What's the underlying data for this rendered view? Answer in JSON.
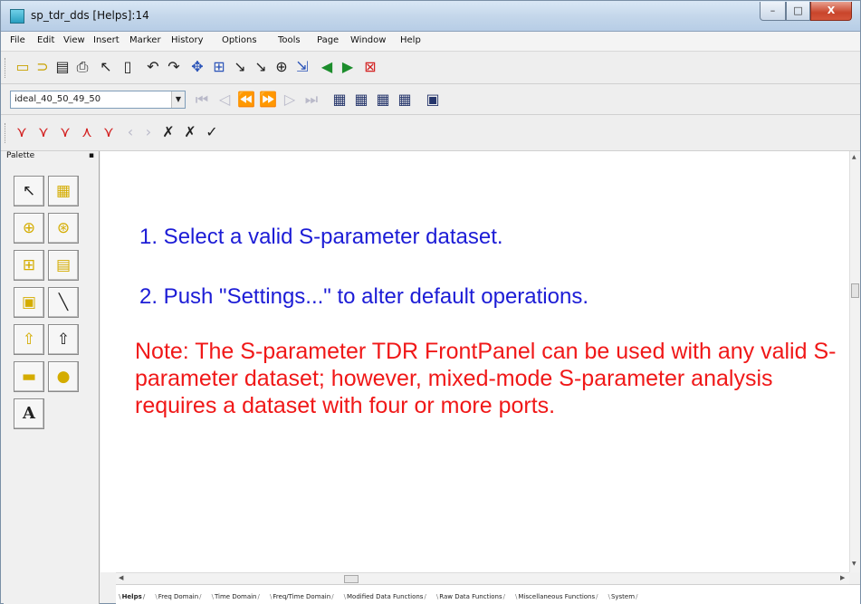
{
  "window": {
    "title": "sp_tdr_dds [Helps]:14",
    "controls": {
      "min": "–",
      "max": "□",
      "close": "X"
    }
  },
  "menu": [
    "File",
    "Edit",
    "View",
    "Insert",
    "Marker",
    "History",
    "Options",
    "Tools",
    "Page",
    "Window",
    "Help"
  ],
  "toolbar": {
    "dataset_selector": {
      "value": "ideal_40_50_49_50"
    }
  },
  "palette": {
    "title": "Palette",
    "text_tool": "A"
  },
  "content": {
    "line1": "1. Select a valid S-parameter dataset.",
    "line2": "2. Push \"Settings...\" to alter default operations.",
    "note": "Note: The S-parameter TDR FrontPanel can be used with any valid S-parameter dataset; however, mixed-mode S-parameter analysis requires a dataset with four or more ports.",
    "line_color": "#1c1cd6",
    "note_color": "#f01818"
  },
  "tabs": [
    "Helps",
    "Freq Domain",
    "Time Domain",
    "Freq/Time Domain",
    "Modified Data Functions",
    "Raw Data Functions",
    "Miscellaneous Functions",
    "System"
  ],
  "active_tab": "Helps"
}
